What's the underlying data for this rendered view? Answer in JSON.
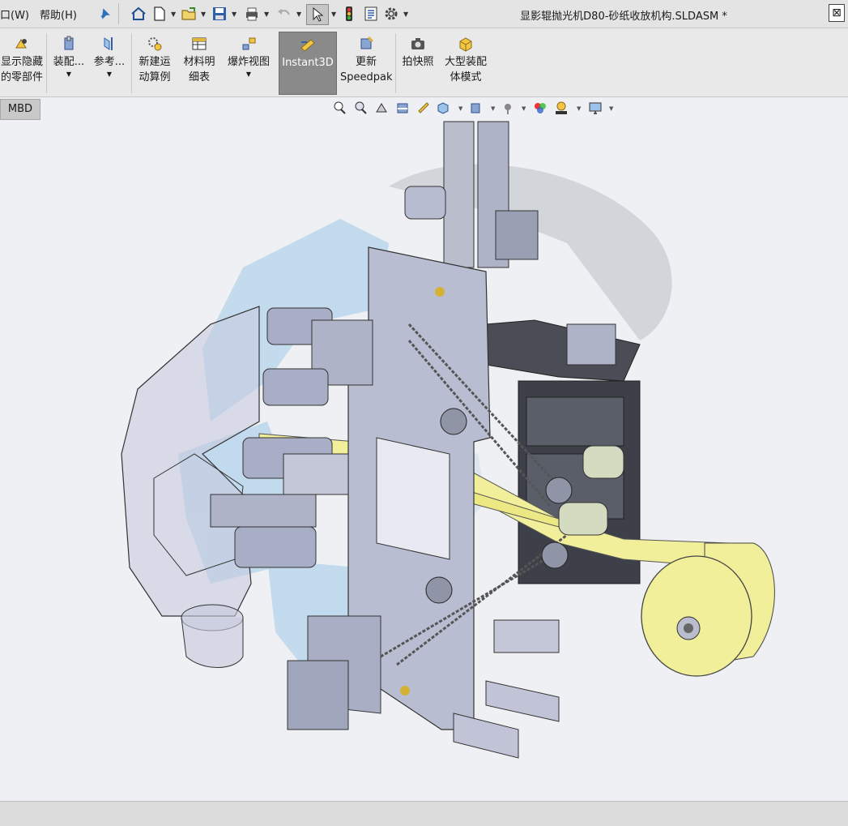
{
  "menubar": {
    "window_label": "口(W)",
    "help_label": "帮助(H)"
  },
  "title": {
    "document": "显影辊抛光机D80-砂纸收放机构.SLDASM *"
  },
  "ribbon": {
    "show_hidden": [
      "显示隐藏",
      "的零部件"
    ],
    "assembly": "装配...",
    "reference": "参考...",
    "new_motion": [
      "新建运",
      "动算例"
    ],
    "bom": [
      "材料明",
      "细表"
    ],
    "exploded": "爆炸视图",
    "instant3d": "Instant3D",
    "speedpak": [
      "更新",
      "Speedpak"
    ],
    "snapshot": "拍快照",
    "large_asm": [
      "大型装配",
      "体模式"
    ]
  },
  "tabs": {
    "mbd": "MBD"
  },
  "colors": {
    "accent_yellow": "#f2ef9a",
    "steel": "#aeb3c7",
    "dark_plate": "#4a4d55",
    "watermark_blue": "#9cc8e6"
  }
}
